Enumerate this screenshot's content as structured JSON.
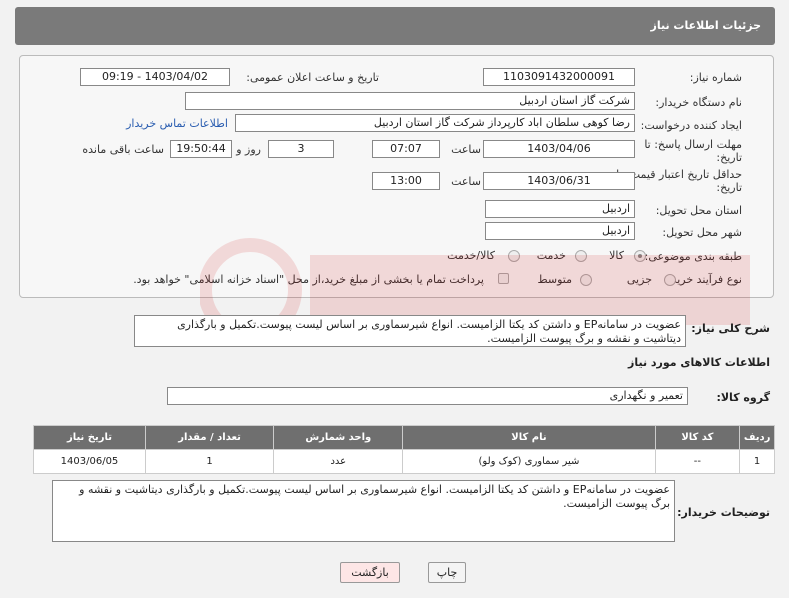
{
  "header": {
    "title": "جزئیات اطلاعات نیاز"
  },
  "form": {
    "need_number": {
      "label": "شماره نیاز:",
      "value": "1103091432000091"
    },
    "announce_datetime": {
      "label": "تاریخ و ساعت اعلان عمومی:",
      "value": "1403/04/02 - 09:19"
    },
    "buyer_org": {
      "label": "نام دستگاه خریدار:",
      "value": "شرکت گاز استان اردبیل"
    },
    "requester": {
      "label": "ایجاد کننده درخواست:",
      "value": "رضا کوهی سلطان اباد کارپرداز شرکت گاز استان اردبیل",
      "contact_link": "اطلاعات تماس خریدار"
    },
    "reply_deadline": {
      "label_line1": "مهلت ارسال پاسخ: تا",
      "label_line2": "تاریخ:",
      "date": "1403/04/06",
      "time_label": "ساعت",
      "time": "07:07",
      "days": "3",
      "days_label": "روز و",
      "remaining": "19:50:44",
      "remaining_label": "ساعت باقی مانده"
    },
    "price_validity": {
      "label_line1": "حداقل تاریخ اعتبار قیمت: تا",
      "label_line2": "تاریخ:",
      "date": "1403/06/31",
      "time_label": "ساعت",
      "time": "13:00"
    },
    "delivery_province": {
      "label": "استان محل تحویل:",
      "value": "اردبیل"
    },
    "delivery_city": {
      "label": "شهر محل تحویل:",
      "value": "اردبیل"
    },
    "category": {
      "label": "طبقه بندی موضوعی:",
      "options": [
        "کالا",
        "خدمت",
        "کالا/خدمت"
      ],
      "selected": "کالا"
    },
    "purchase_type": {
      "label": "نوع فرآیند خرید :",
      "options": [
        "جزیی",
        "متوسط"
      ],
      "payment_note": "پرداخت تمام یا بخشی از مبلغ خرید،از محل \"اسناد خزانه اسلامی\" خواهد بود."
    }
  },
  "summary": {
    "label": "شرح کلی نیاز:",
    "text": "عضویت در سامانهEP و داشتن کد یکتا الزامیست. انواع شیرسماوری بر اساس لیست پیوست.تکمیل و بارگذاری دیتاشیت و نقشه و برگ پیوست الزامیست."
  },
  "goods_section": {
    "title": "اطلاعات کالاهای مورد نیاز",
    "group_label": "گروه کالا:",
    "group_value": "تعمیر و نگهداری"
  },
  "table": {
    "headers": [
      "ردیف",
      "کد کالا",
      "نام کالا",
      "واحد شمارش",
      "تعداد / مقدار",
      "تاریخ نیاز"
    ],
    "rows": [
      [
        "1",
        "--",
        "شیر سماوری (کوک ولو)",
        "عدد",
        "1",
        "1403/06/05"
      ]
    ]
  },
  "buyer_notes": {
    "label": "توضیحات خریدار:",
    "text": "عضویت در سامانهEP و داشتن کد یکتا الزامیست. انواع شیرسماوری بر اساس لیست پیوست.تکمیل و بارگذاری دیتاشیت و نقشه و برگ پیوست الزامیست."
  },
  "buttons": {
    "print": "چاپ",
    "back": "بازگشت"
  },
  "colors": {
    "header_bg": "#7a7a7a",
    "link": "#2a5db0",
    "back_button_bg": "#fde6e6"
  }
}
